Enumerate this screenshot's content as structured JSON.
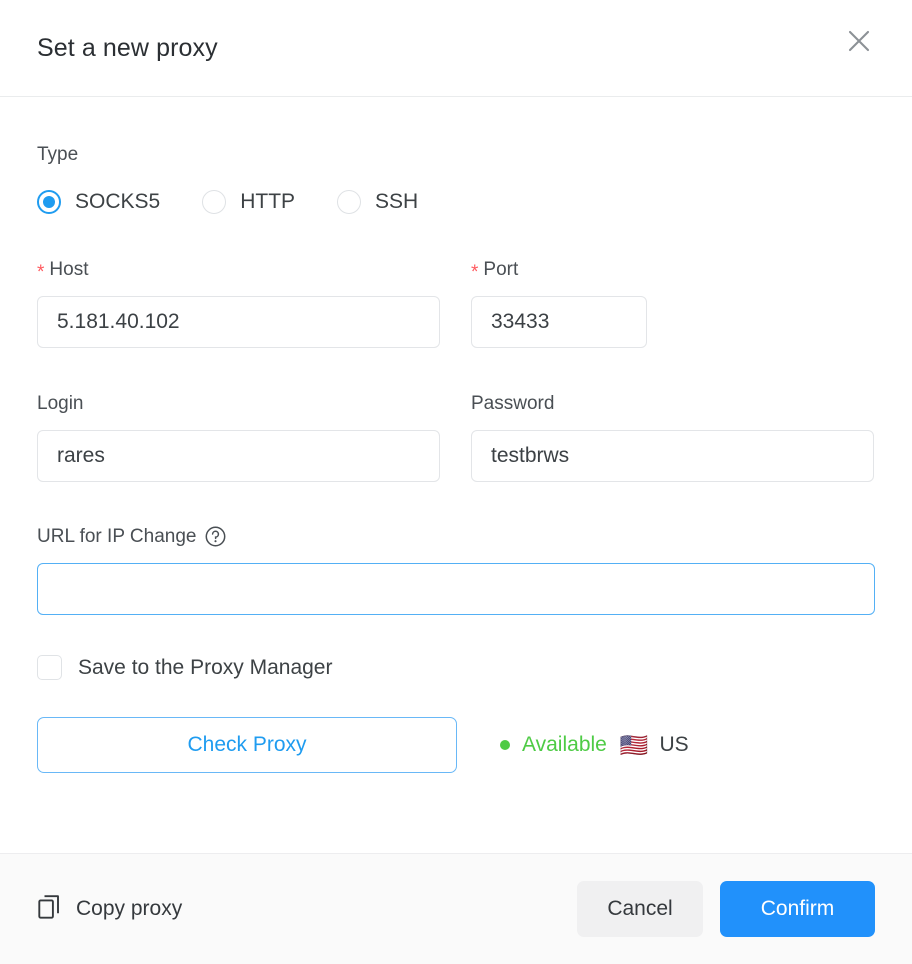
{
  "dialog": {
    "title": "Set a new proxy",
    "close_icon": "close-icon"
  },
  "type_section": {
    "label": "Type",
    "options": [
      {
        "label": "SOCKS5",
        "selected": true
      },
      {
        "label": "HTTP",
        "selected": false
      },
      {
        "label": "SSH",
        "selected": false
      }
    ]
  },
  "host": {
    "label": "Host",
    "required_marker": "*",
    "value": "5.181.40.102",
    "placeholder": ""
  },
  "port": {
    "label": "Port",
    "required_marker": "*",
    "value": "33433",
    "placeholder": ""
  },
  "login": {
    "label": "Login",
    "value": "rares",
    "placeholder": ""
  },
  "password": {
    "label": "Password",
    "value": "testbrws",
    "placeholder": ""
  },
  "url_ip_change": {
    "label": "URL for IP Change",
    "help_icon": "question-circle-icon",
    "value": "",
    "placeholder": "",
    "focused": true
  },
  "save_checkbox": {
    "label": "Save to the Proxy Manager",
    "checked": false
  },
  "check_proxy": {
    "button_label": "Check Proxy",
    "status_text": "Available",
    "status_color": "#4ecb45",
    "flag": "🇺🇸",
    "country_code": "US"
  },
  "footer": {
    "copy_icon": "copy-icon",
    "copy_label": "Copy proxy",
    "cancel_label": "Cancel",
    "confirm_label": "Confirm"
  },
  "colors": {
    "accent_blue": "#2191fb",
    "link_blue": "#1f9cf0",
    "required_red": "#ff5a5f",
    "status_green": "#4ecb45",
    "footer_bg": "#fafafa"
  }
}
